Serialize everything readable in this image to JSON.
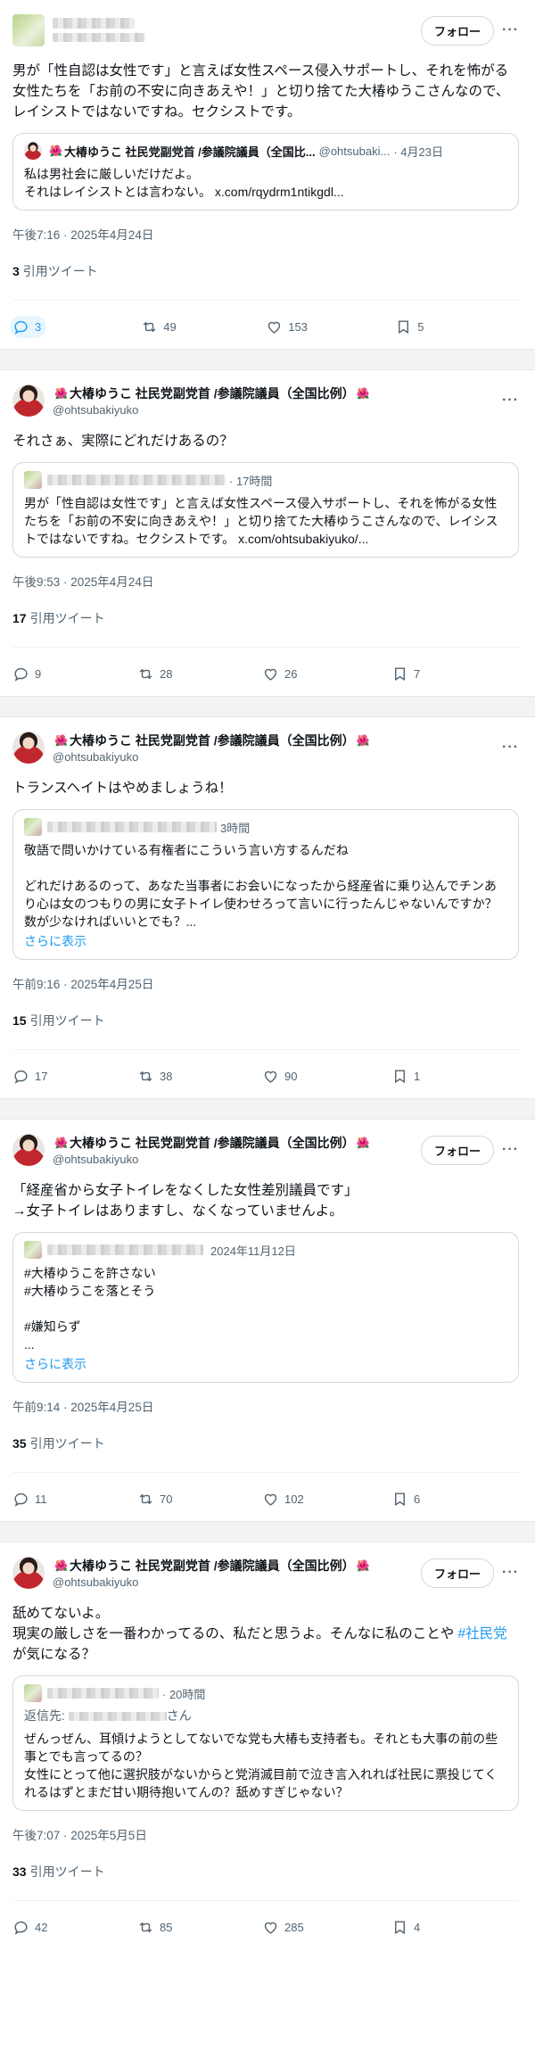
{
  "follow_label": "フォロー",
  "quotes_label": "引用ツイート",
  "show_more": "さらに表示",
  "flower": "🌺",
  "tweets": [
    {
      "author": {
        "name": "",
        "handle": ""
      },
      "follow_visible": true,
      "text": "男が「性自認は女性です」と言えば女性スペース侵入サポートし、それを怖がる女性たちを「お前の不安に向きあえや！」と切り捨てた大椿ゆうこさんなので、レイシストではないですね。セクシストです。",
      "quote": {
        "name": "大椿ゆうこ 社民党副党首 /参議院議員（全国比...",
        "handle": "@ohtsubaki...",
        "date": "· 4月23日",
        "text": "私は男社会に厳しいだけだよ。\nそれはレイシストとは言わない。 x.com/rqydrm1ntikgdl..."
      },
      "timestamp": "午後7:16 · 2025年4月24日",
      "quote_count": "3",
      "replies": "3",
      "retweets": "49",
      "likes": "153",
      "bookmarks": "5"
    },
    {
      "author": {
        "name": "大椿ゆうこ 社民党副党首 /参議院議員（全国比例）",
        "handle": "@ohtsubakiyuko"
      },
      "follow_visible": false,
      "text": "それさぁ、実際にどれだけあるの？",
      "quote": {
        "time": "· 17時間",
        "text": "男が「性自認は女性です」と言えば女性スペース侵入サポートし、それを怖がる女性たちを「お前の不安に向きあえや！」と切り捨てた大椿ゆうこさんなので、レイシストではないですね。セクシストです。 x.com/ohtsubakiyuko/..."
      },
      "timestamp": "午後9:53 · 2025年4月24日",
      "quote_count": "17",
      "replies": "9",
      "retweets": "28",
      "likes": "26",
      "bookmarks": "7"
    },
    {
      "author": {
        "name": "大椿ゆうこ 社民党副党首 /参議院議員（全国比例）",
        "handle": "@ohtsubakiyuko"
      },
      "follow_visible": false,
      "text": "トランスヘイトはやめましょうね！",
      "quote": {
        "time": "3時間",
        "text": "敬語で問いかけている有権者にこういう言い方するんだね\n\nどれだけあるのって、あなた当事者にお会いになったから経産省に乗り込んでチンあり心は女のつもりの男に女子トイレ使わせろって言いに行ったんじゃないんですか？数が少なければいいとでも？..."
      },
      "timestamp": "午前9:16 · 2025年4月25日",
      "quote_count": "15",
      "replies": "17",
      "retweets": "38",
      "likes": "90",
      "bookmarks": "1"
    },
    {
      "author": {
        "name": "大椿ゆうこ 社民党副党首 /参議院議員（全国比例）",
        "handle": "@ohtsubakiyuko"
      },
      "follow_visible": true,
      "text": "「経産省から女子トイレをなくした女性差別議員です」\n→女子トイレはありますし、なくなっていませんよ。",
      "quote": {
        "time": "2024年11月12日",
        "text": "#大椿ゆうこを許さない\n#大椿ゆうこを落とそう\n\n#嫌知らず\n..."
      },
      "timestamp": "午前9:14 · 2025年4月25日",
      "quote_count": "35",
      "replies": "11",
      "retweets": "70",
      "likes": "102",
      "bookmarks": "6"
    },
    {
      "author": {
        "name": "大椿ゆうこ 社民党副党首 /参議院議員（全国比例）",
        "handle": "@ohtsubakiyuko"
      },
      "follow_visible": true,
      "text_before": "舐めてないよ。\n現実の厳しさを一番わかってるの、私だと思うよ。そんなに私のことや ",
      "text_hashtag": "#社民党",
      "text_after": " が気になる？",
      "quote": {
        "time": "· 20時間",
        "reply_to_prefix": "返信先: ",
        "reply_to_suffix": "さん",
        "text": "ぜんっぜん、耳傾けようとしてないでな党も大椿も支持者も。それとも大事の前の些事とでも言ってるの？\n女性にとって他に選択肢がないからと党消滅目前で泣き言入れれば社民に票投じてくれるはずとまだ甘い期待抱いてんの？舐めすぎじゃない？"
      },
      "timestamp": "午後7:07 · 2025年5月5日",
      "quote_count": "33",
      "replies": "42",
      "retweets": "85",
      "likes": "285",
      "bookmarks": "4"
    }
  ]
}
